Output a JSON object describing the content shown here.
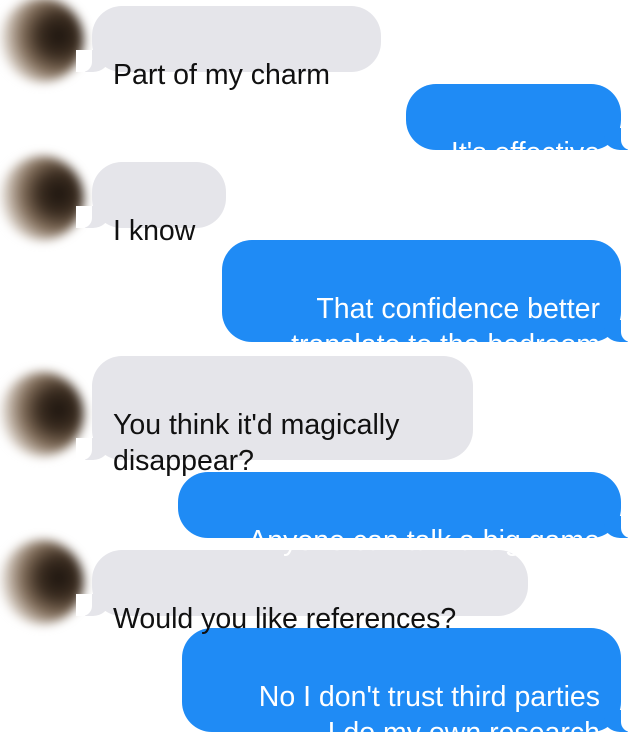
{
  "conversation": {
    "messages": [
      {
        "sender": "them",
        "text": "Part of my charm"
      },
      {
        "sender": "me",
        "text": "It's effective"
      },
      {
        "sender": "them",
        "text": "I know"
      },
      {
        "sender": "me",
        "text": "That confidence better\ntranslate to the bedroom"
      },
      {
        "sender": "them",
        "text": "You think it'd magically\ndisappear?"
      },
      {
        "sender": "me",
        "text": "Anyone can talk a big game"
      },
      {
        "sender": "them",
        "text": "Would you like references?"
      },
      {
        "sender": "me",
        "text": "No I don't trust third parties\nI do my own research"
      }
    ]
  },
  "colors": {
    "incoming_bubble": "#e5e5ea",
    "outgoing_bubble": "#1f8bf5",
    "incoming_text": "#111111",
    "outgoing_text": "#ffffff"
  }
}
